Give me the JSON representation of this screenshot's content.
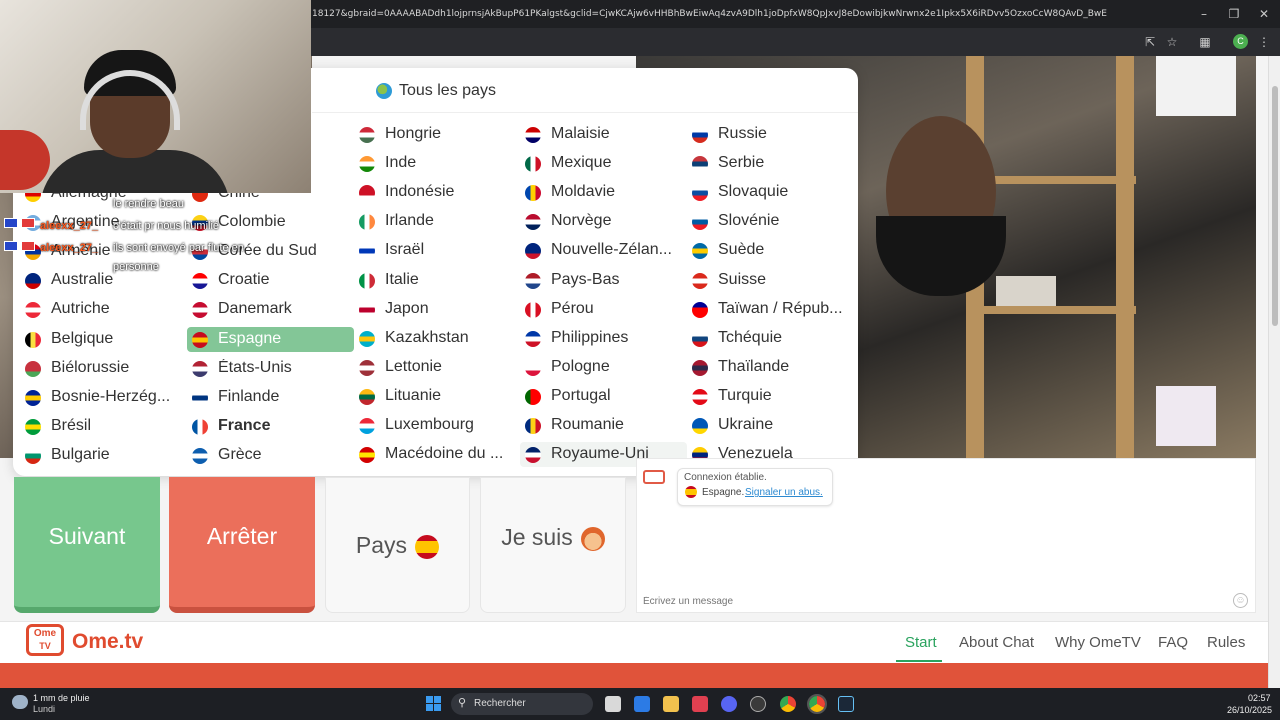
{
  "browser": {
    "url": "18127&gbraid=0AAAABADdh1lojprnsjAkBupP61PKalgst&gclid=CjwKCAjw6vHHBhBwEiwAq4zvA9Dlh1joDpfxW8QpJxvJ8eDowibjkwNrwnx2e1Ipkx5X6iRDvv5OzxoCcW8QAvD_BwE",
    "profile_initial": "C"
  },
  "country_panel": {
    "all_label": "Tous les pays",
    "columns": [
      [
        {
          "name": "Allemagne",
          "flag": [
            "#000000",
            "#dd0000",
            "#ffce00"
          ]
        },
        {
          "name": "Argentine",
          "flag": [
            "#74acdf",
            "#ffffff",
            "#74acdf"
          ]
        },
        {
          "name": "Arménie",
          "flag": [
            "#d90012",
            "#0033a0",
            "#f2a800"
          ]
        },
        {
          "name": "Australie",
          "flag": [
            "#00247d",
            "#00247d",
            "#cc0000"
          ]
        },
        {
          "name": "Autriche",
          "flag": [
            "#ed2939",
            "#ffffff",
            "#ed2939"
          ]
        },
        {
          "name": "Belgique",
          "flag": [
            "#000000",
            "#fae042",
            "#ed2939"
          ],
          "vertical": true
        },
        {
          "name": "Biélorussie",
          "flag": [
            "#c8313e",
            "#c8313e",
            "#4aa657"
          ]
        },
        {
          "name": "Bosnie-Herzég...",
          "flag": [
            "#002395",
            "#fecb00",
            "#002395"
          ]
        },
        {
          "name": "Brésil",
          "flag": [
            "#009c3b",
            "#ffdf00",
            "#009c3b"
          ]
        },
        {
          "name": "Bulgarie",
          "flag": [
            "#ffffff",
            "#00966e",
            "#d62612"
          ]
        }
      ],
      [
        {
          "name": "Chine",
          "flag": [
            "#de2910",
            "#de2910",
            "#de2910"
          ]
        },
        {
          "name": "Colombie",
          "flag": [
            "#fcd116",
            "#003893",
            "#ce1126"
          ]
        },
        {
          "name": "Corée du Sud",
          "flag": [
            "#ffffff",
            "#cd2e3a",
            "#0047a0"
          ]
        },
        {
          "name": "Croatie",
          "flag": [
            "#ff0000",
            "#ffffff",
            "#171796"
          ]
        },
        {
          "name": "Danemark",
          "flag": [
            "#c60c30",
            "#ffffff",
            "#c60c30"
          ]
        },
        {
          "name": "Espagne",
          "flag": [
            "#c60b1e",
            "#ffc400",
            "#c60b1e"
          ],
          "selected": true
        },
        {
          "name": "États-Unis",
          "flag": [
            "#b22234",
            "#ffffff",
            "#3c3b6e"
          ]
        },
        {
          "name": "Finlande",
          "flag": [
            "#ffffff",
            "#003580",
            "#ffffff"
          ]
        },
        {
          "name": "France",
          "flag": [
            "#0055a4",
            "#ffffff",
            "#ef4135"
          ],
          "vertical": true,
          "bold": true
        },
        {
          "name": "Grèce",
          "flag": [
            "#0d5eaf",
            "#ffffff",
            "#0d5eaf"
          ]
        }
      ],
      [
        {
          "name": "Hongrie",
          "flag": [
            "#ce2939",
            "#ffffff",
            "#477050"
          ]
        },
        {
          "name": "Inde",
          "flag": [
            "#ff9933",
            "#ffffff",
            "#138808"
          ]
        },
        {
          "name": "Indonésie",
          "flag": [
            "#ce1126",
            "#ce1126",
            "#ffffff"
          ]
        },
        {
          "name": "Irlande",
          "flag": [
            "#169b62",
            "#ffffff",
            "#ff883e"
          ],
          "vertical": true
        },
        {
          "name": "Israël",
          "flag": [
            "#ffffff",
            "#0038b8",
            "#ffffff"
          ]
        },
        {
          "name": "Italie",
          "flag": [
            "#009246",
            "#ffffff",
            "#ce2b37"
          ],
          "vertical": true
        },
        {
          "name": "Japon",
          "flag": [
            "#ffffff",
            "#bc002d",
            "#ffffff"
          ]
        },
        {
          "name": "Kazakhstan",
          "flag": [
            "#00afca",
            "#fec50c",
            "#00afca"
          ]
        },
        {
          "name": "Lettonie",
          "flag": [
            "#9e3039",
            "#ffffff",
            "#9e3039"
          ]
        },
        {
          "name": "Lituanie",
          "flag": [
            "#fdb913",
            "#006a44",
            "#c1272d"
          ]
        },
        {
          "name": "Luxembourg",
          "flag": [
            "#ed2939",
            "#ffffff",
            "#00a1de"
          ]
        },
        {
          "name": "Macédoine du ...",
          "flag": [
            "#d20000",
            "#ffe600",
            "#d20000"
          ]
        }
      ],
      [
        {
          "name": "Malaisie",
          "flag": [
            "#cc0001",
            "#ffffff",
            "#010066"
          ]
        },
        {
          "name": "Mexique",
          "flag": [
            "#006847",
            "#ffffff",
            "#ce1126"
          ],
          "vertical": true
        },
        {
          "name": "Moldavie",
          "flag": [
            "#0046ae",
            "#ffd200",
            "#cc092f"
          ],
          "vertical": true
        },
        {
          "name": "Norvège",
          "flag": [
            "#ba0c2f",
            "#ffffff",
            "#00205b"
          ]
        },
        {
          "name": "Nouvelle-Zélan...",
          "flag": [
            "#00247d",
            "#00247d",
            "#cc142b"
          ]
        },
        {
          "name": "Pays-Bas",
          "flag": [
            "#ae1c28",
            "#ffffff",
            "#21468b"
          ]
        },
        {
          "name": "Pérou",
          "flag": [
            "#d91023",
            "#ffffff",
            "#d91023"
          ],
          "vertical": true
        },
        {
          "name": "Philippines",
          "flag": [
            "#0038a8",
            "#ffffff",
            "#ce1126"
          ]
        },
        {
          "name": "Pologne",
          "flag": [
            "#ffffff",
            "#ffffff",
            "#dc143c"
          ]
        },
        {
          "name": "Portugal",
          "flag": [
            "#006600",
            "#ff0000",
            "#ff0000"
          ],
          "vertical": true
        },
        {
          "name": "Roumanie",
          "flag": [
            "#002b7f",
            "#fcd116",
            "#ce1126"
          ],
          "vertical": true
        },
        {
          "name": "Royaume-Uni",
          "flag": [
            "#012169",
            "#ffffff",
            "#c8102e"
          ],
          "hover": true
        }
      ],
      [
        {
          "name": "Russie",
          "flag": [
            "#ffffff",
            "#0039a6",
            "#d52b1e"
          ]
        },
        {
          "name": "Serbie",
          "flag": [
            "#c6363c",
            "#0c4076",
            "#ffffff"
          ]
        },
        {
          "name": "Slovaquie",
          "flag": [
            "#ffffff",
            "#0b4ea2",
            "#ee1c25"
          ]
        },
        {
          "name": "Slovénie",
          "flag": [
            "#ffffff",
            "#005da4",
            "#ed1c24"
          ]
        },
        {
          "name": "Suède",
          "flag": [
            "#006aa7",
            "#fecc00",
            "#006aa7"
          ]
        },
        {
          "name": "Suisse",
          "flag": [
            "#da291c",
            "#ffffff",
            "#da291c"
          ]
        },
        {
          "name": "Taïwan / Répub...",
          "flag": [
            "#000095",
            "#fe0000",
            "#fe0000"
          ]
        },
        {
          "name": "Tchéquie",
          "flag": [
            "#ffffff",
            "#11457e",
            "#d7141a"
          ]
        },
        {
          "name": "Thaïlande",
          "flag": [
            "#a51931",
            "#2d2a4a",
            "#a51931"
          ]
        },
        {
          "name": "Turquie",
          "flag": [
            "#e30a17",
            "#ffffff",
            "#e30a17"
          ]
        },
        {
          "name": "Ukraine",
          "flag": [
            "#0057b7",
            "#0057b7",
            "#ffd700"
          ]
        },
        {
          "name": "Venezuela",
          "flag": [
            "#ffcc00",
            "#00247d",
            "#cf142b"
          ]
        }
      ]
    ]
  },
  "chat_overlay": {
    "lines": [
      {
        "user": "",
        "msg": "le rendre beau"
      },
      {
        "user": "aleexx_27_",
        "msg": "c'était pr nous humilié"
      },
      {
        "user": "aleexx_27_",
        "msg": "ils sont envoyé par flute en"
      },
      {
        "user": "",
        "msg": "personne"
      }
    ]
  },
  "buttons": {
    "next": "Suivant",
    "stop": "Arrêter",
    "country": "Pays",
    "iam": "Je suis"
  },
  "chat": {
    "status": "Connexion établie.",
    "country": "Espagne.",
    "report": "Signaler un abus.",
    "placeholder": "Écrivez un message"
  },
  "footer": {
    "logo_small_1": "Ome",
    "logo_small_2": "TV",
    "logo_text": "Ome.tv",
    "nav": {
      "start": "Start",
      "about": "About Chat",
      "why": "Why OmeTV",
      "faq": "FAQ",
      "rules": "Rules"
    }
  },
  "taskbar": {
    "weather": "1 mm de pluie",
    "weather_day": "Lundi",
    "search": "Rechercher",
    "time": "02:57",
    "date": "26/10/2025"
  },
  "colors": {
    "selected_green": "#83c697",
    "next_green": "#77c78d",
    "stop_red": "#eb6f5b",
    "brand_red": "#e04b2f",
    "nav_active": "#2aa35e"
  }
}
